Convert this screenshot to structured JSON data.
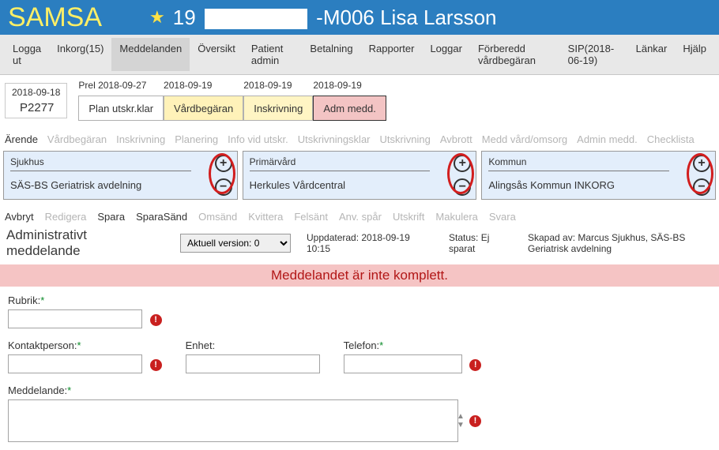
{
  "header": {
    "app": "SAMSA",
    "patient_prefix": "19",
    "patient_suffix": "-M006 Lisa Larsson"
  },
  "menu": {
    "logout": "Logga ut",
    "inbox": "Inkorg(15)",
    "messages": "Meddelanden",
    "overview": "Översikt",
    "patient_admin": "Patient admin",
    "payment": "Betalning",
    "reports": "Rapporter",
    "logs": "Loggar",
    "prepared": "Förberedd vårdbegäran",
    "sip": "SIP(2018-06-19)",
    "links": "Länkar",
    "help": "Hjälp"
  },
  "current": {
    "date": "2018-09-18",
    "code": "P2277"
  },
  "timeline": [
    {
      "date": "Prel 2018-09-27",
      "label": "Plan utskr.klar",
      "cls": ""
    },
    {
      "date": "2018-09-19",
      "label": "Vårdbegäran",
      "cls": "yellow"
    },
    {
      "date": "2018-09-19",
      "label": "Inskrivning",
      "cls": "yellow2"
    },
    {
      "date": "2018-09-19",
      "label": "Adm medd.",
      "cls": "pink"
    }
  ],
  "tabs": {
    "arende": "Ärende",
    "vardbegaran": "Vårdbegäran",
    "inskrivning": "Inskrivning",
    "planering": "Planering",
    "info_vid_utskr": "Info vid utskr.",
    "utskrivningsklar": "Utskrivningsklar",
    "utskrivning": "Utskrivning",
    "avbrott": "Avbrott",
    "medd_vard": "Medd vård/omsorg",
    "admin_medd": "Admin medd.",
    "checklista": "Checklista"
  },
  "panels": {
    "hosp_label": "Sjukhus",
    "hosp_value": "SÄS-BS Geriatrisk avdelning",
    "prim_label": "Primärvård",
    "prim_value": "Herkules Vårdcentral",
    "komm_label": "Kommun",
    "komm_value": "Alingsås Kommun INKORG"
  },
  "actions": {
    "avbryt": "Avbryt",
    "redigera": "Redigera",
    "spara": "Spara",
    "sparasand": "SparaSänd",
    "omsand": "Omsänd",
    "kvittera": "Kvittera",
    "felsant": "Felsänt",
    "anvspar": "Anv. spår",
    "utskrift": "Utskrift",
    "makulera": "Makulera",
    "svara": "Svara"
  },
  "msg": {
    "title": "Administrativt meddelande",
    "version_label": "Aktuell version: 0",
    "updated": "Uppdaterad: 2018-09-19 10:15",
    "status": "Status: Ej sparat",
    "created": "Skapad av: Marcus Sjukhus, SÄS-BS Geriatrisk avdelning",
    "alert": "Meddelandet är inte komplett."
  },
  "form": {
    "rubrik": "Rubrik:",
    "kontakt": "Kontaktperson:",
    "enhet": "Enhet:",
    "telefon": "Telefon:",
    "medd": "Meddelande:",
    "star": "*",
    "err": "!"
  }
}
